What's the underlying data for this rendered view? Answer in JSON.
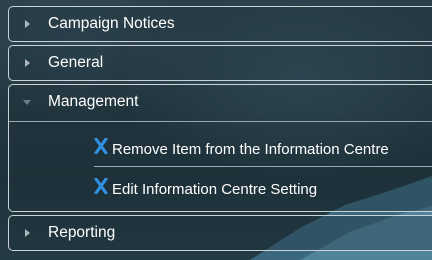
{
  "sections": [
    {
      "label": "Campaign Notices",
      "expanded": false
    },
    {
      "label": "General",
      "expanded": false
    },
    {
      "label": "Management",
      "expanded": true,
      "items": [
        {
          "label": "Remove Item from the Information Centre",
          "icon": "x-icon"
        },
        {
          "label": "Edit Information Centre Setting",
          "icon": "x-icon"
        }
      ]
    },
    {
      "label": "Reporting",
      "expanded": false
    }
  ],
  "colors": {
    "icon_blue": "#2f8fe0",
    "text": "#ffffff",
    "border": "#c9d2d6"
  }
}
